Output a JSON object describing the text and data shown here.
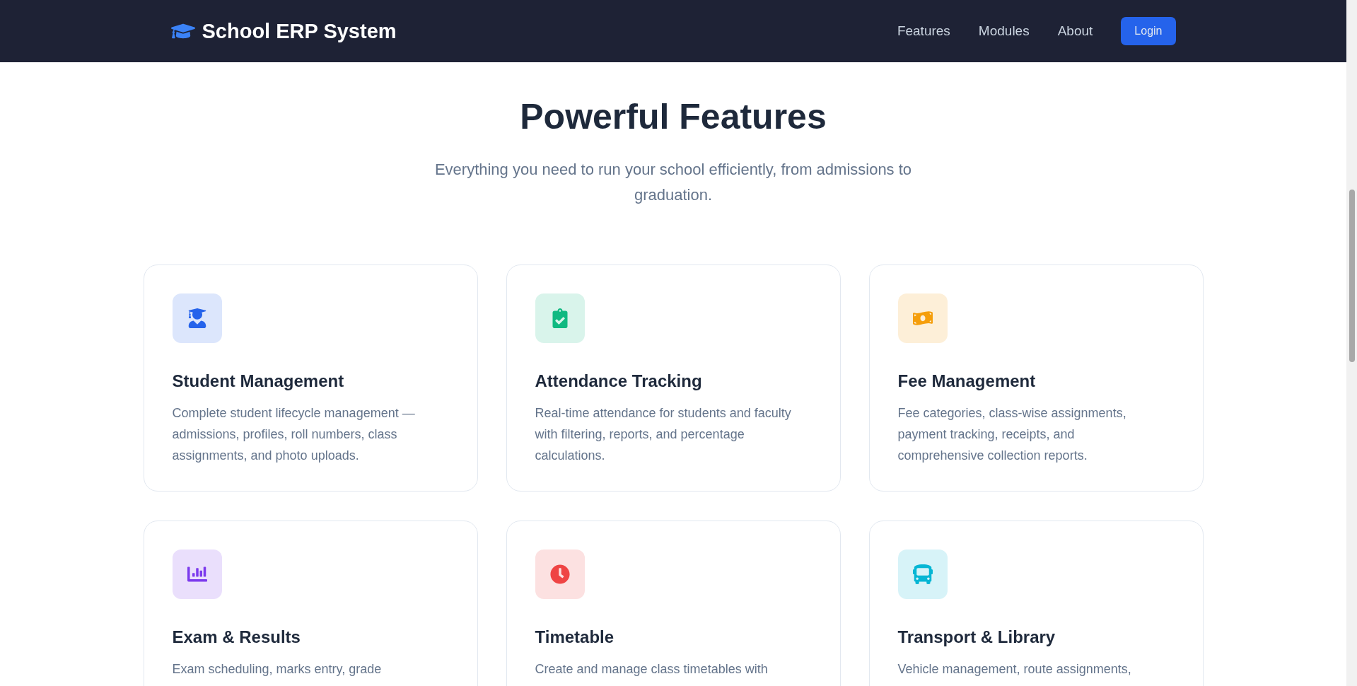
{
  "header": {
    "brand": "School ERP System",
    "nav": [
      "Features",
      "Modules",
      "About"
    ],
    "login": "Login"
  },
  "hero": {
    "title": "Powerful Features",
    "subtitle": "Everything you need to run your school efficiently, from admissions to graduation."
  },
  "features": [
    {
      "title": "Student Management",
      "description": "Complete student lifecycle management — admissions, profiles, roll numbers, class assignments, and photo uploads.",
      "color": "#2563eb"
    },
    {
      "title": "Attendance Tracking",
      "description": "Real-time attendance for students and faculty with filtering, reports, and percentage calculations.",
      "color": "#10b981"
    },
    {
      "title": "Fee Management",
      "description": "Fee categories, class-wise assignments, payment tracking, receipts, and comprehensive collection reports.",
      "color": "#f59e0b"
    },
    {
      "title": "Exam & Results",
      "description": "Exam scheduling, marks entry, grade",
      "color": "#7c3aed"
    },
    {
      "title": "Timetable",
      "description": "Create and manage class timetables with",
      "color": "#ef4444"
    },
    {
      "title": "Transport & Library",
      "description": "Vehicle management, route assignments,",
      "color": "#06b6d4"
    }
  ]
}
